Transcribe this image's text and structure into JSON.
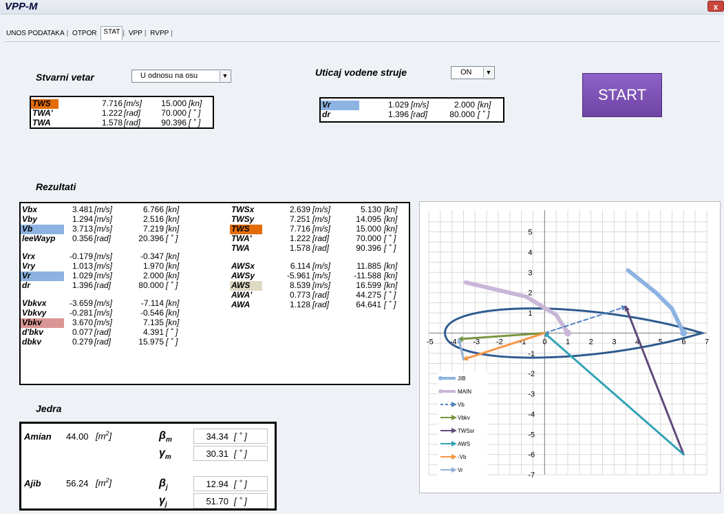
{
  "window": {
    "title": "VPP-M",
    "close_label": "x"
  },
  "tabs": [
    {
      "label": "UNOS PODATAKA",
      "active": false
    },
    {
      "label": "OTPOR",
      "active": false
    },
    {
      "label": "STAT",
      "active": true
    },
    {
      "label": "VPP",
      "active": false
    },
    {
      "label": "RVPP",
      "active": false
    }
  ],
  "stvarni_vetar": {
    "heading": "Stvarni vetar",
    "dropdown_value": "U odnosu na osu",
    "rows": [
      {
        "name": "TWS",
        "v1": "7.716",
        "u1": "[m/s]",
        "v2": "15.000",
        "u2": "[kn]",
        "highlight": "#e36c09"
      },
      {
        "name": "TWA'",
        "v1": "1.222",
        "u1": "[rad]",
        "v2": "70.000",
        "u2": "[ ˚ ]",
        "highlight": ""
      },
      {
        "name": "TWA",
        "v1": "1.578",
        "u1": "[rad]",
        "v2": "90.396",
        "u2": "[ ˚ ]",
        "highlight": ""
      }
    ]
  },
  "uticaj": {
    "heading": "Uticaj vodene struje",
    "dropdown_value": "ON",
    "rows": [
      {
        "name": "Vr",
        "v1": "1.029",
        "u1": "[m/s]",
        "v2": "2.000",
        "u2": "[kn]",
        "highlight": "#8db3e2"
      },
      {
        "name": "dr",
        "v1": "1.396",
        "u1": "[rad]",
        "v2": "80.000",
        "u2": "[ ˚ ]",
        "highlight": ""
      }
    ]
  },
  "start_label": "START",
  "rezultati": {
    "heading": "Rezultati",
    "left_rows": [
      {
        "name": "Vbx",
        "v1": "3.481",
        "u1": "[m/s]",
        "v2": "6.766",
        "u2": "[kn]",
        "highlight": ""
      },
      {
        "name": "Vby",
        "v1": "1.294",
        "u1": "[m/s]",
        "v2": "2.516",
        "u2": "[kn]",
        "highlight": ""
      },
      {
        "name": "Vb",
        "v1": "3.713",
        "u1": "[m/s]",
        "v2": "7.219",
        "u2": "[kn]",
        "highlight": "#8db3e2"
      },
      {
        "name": "leeWayp",
        "v1": "0.356",
        "u1": "[rad]",
        "v2": "20.396",
        "u2": "[ ˚ ]",
        "highlight": ""
      },
      {
        "name": "Vrx",
        "v1": "-0.179",
        "u1": "[m/s]",
        "v2": "-0.347",
        "u2": "[kn]",
        "highlight": ""
      },
      {
        "name": "Vry",
        "v1": "1.013",
        "u1": "[m/s]",
        "v2": "1.970",
        "u2": "[kn]",
        "highlight": ""
      },
      {
        "name": "Vr",
        "v1": "1.029",
        "u1": "[m/s]",
        "v2": "2.000",
        "u2": "[kn]",
        "highlight": "#8db3e2"
      },
      {
        "name": "dr",
        "v1": "1.396",
        "u1": "[rad]",
        "v2": "80.000",
        "u2": "[ ˚ ]",
        "highlight": ""
      },
      {
        "name": "Vbkvx",
        "v1": "-3.659",
        "u1": "[m/s]",
        "v2": "-7.114",
        "u2": "[kn]",
        "highlight": ""
      },
      {
        "name": "Vbkvy",
        "v1": "-0.281",
        "u1": "[m/s]",
        "v2": "-0.546",
        "u2": "[kn]",
        "highlight": ""
      },
      {
        "name": "Vbkv",
        "v1": "3.670",
        "u1": "[m/s]",
        "v2": "7.135",
        "u2": "[kn]",
        "highlight": "#da9694"
      },
      {
        "name": "d'bkv",
        "v1": "0.077",
        "u1": "[rad]",
        "v2": "4.391",
        "u2": "[ ˚ ]",
        "highlight": ""
      },
      {
        "name": "dbkv",
        "v1": "0.279",
        "u1": "[rad]",
        "v2": "15.975",
        "u2": "[ ˚ ]",
        "highlight": ""
      }
    ],
    "right_rows": [
      {
        "name": "TWSx",
        "v1": "2.639",
        "u1": "[m/s]",
        "v2": "5.130",
        "u2": "[kn]",
        "highlight": ""
      },
      {
        "name": "TWSy",
        "v1": "7.251",
        "u1": "[m/s]",
        "v2": "14.095",
        "u2": "[kn]",
        "highlight": ""
      },
      {
        "name": "TWS",
        "v1": "7.716",
        "u1": "[m/s]",
        "v2": "15.000",
        "u2": "[kn]",
        "highlight": "#e36c09"
      },
      {
        "name": "TWA'",
        "v1": "1.222",
        "u1": "[rad]",
        "v2": "70.000",
        "u2": "[ ˚ ]",
        "highlight": ""
      },
      {
        "name": "TWA",
        "v1": "1.578",
        "u1": "[rad]",
        "v2": "90.396",
        "u2": "[ ˚ ]",
        "highlight": ""
      },
      {
        "name": "AWSx",
        "v1": "6.114",
        "u1": "[m/s]",
        "v2": "11.885",
        "u2": "[kn]",
        "highlight": ""
      },
      {
        "name": "AWSy",
        "v1": "-5.961",
        "u1": "[m/s]",
        "v2": "-11.588",
        "u2": "[kn]",
        "highlight": ""
      },
      {
        "name": "AWS",
        "v1": "8.539",
        "u1": "[m/s]",
        "v2": "16.599",
        "u2": "[kn]",
        "highlight": "#ddd9c3"
      },
      {
        "name": "AWA'",
        "v1": "0.773",
        "u1": "[rad]",
        "v2": "44.275",
        "u2": "[ ˚ ]",
        "highlight": ""
      },
      {
        "name": "AWA",
        "v1": "1.128",
        "u1": "[rad]",
        "v2": "64.641",
        "u2": "[ ˚ ]",
        "highlight": ""
      }
    ]
  },
  "jedra": {
    "heading": "Jedra",
    "amian_label": "Amian",
    "amian_value": "44.00",
    "ajib_label": "Ajib",
    "ajib_value": "56.24",
    "area_unit": "[m",
    "area_unit_sup": "2",
    "area_unit_close": "]",
    "beta_m_sym": "β",
    "beta_m_sub": "m",
    "beta_m_value": "34.34",
    "beta_m_unit": "[ ˚ ]",
    "gamma_m_sym": "γ",
    "gamma_m_sub": "m",
    "gamma_m_value": "30.31",
    "gamma_m_unit": "[ ˚ ]",
    "beta_j_sym": "β",
    "beta_j_sub": "j",
    "beta_j_value": "12.94",
    "beta_j_unit": "[ ˚ ]",
    "gamma_j_sym": "γ",
    "gamma_j_sub": "j",
    "gamma_j_value": "51.70",
    "gamma_j_unit": "[ ˚ ]"
  },
  "chart_data": {
    "type": "scatter",
    "title": "",
    "xlabel": "",
    "ylabel": "",
    "xlim": [
      -5,
      7
    ],
    "ylim": [
      -7,
      5
    ],
    "x_ticks": [
      -5,
      -4,
      -3,
      -2,
      -1,
      0,
      1,
      2,
      3,
      4,
      5,
      6,
      7
    ],
    "y_ticks": [
      5,
      4,
      3,
      2,
      1,
      0,
      -1,
      -2,
      -3,
      -4,
      -5,
      -6,
      -7
    ],
    "grid": true,
    "legend": "bottom-left",
    "hull": {
      "x_min": -4.3,
      "x_max": 6.8,
      "y_center": 0.0,
      "half_width": 1.2,
      "color": "#2e5b8e"
    },
    "series": [
      {
        "name": "JIB",
        "color": "#8db3e2",
        "points": [
          [
            6.0,
            0.0
          ],
          [
            5.5,
            1.2
          ],
          [
            4.8,
            2.0
          ],
          [
            3.6,
            3.1
          ]
        ],
        "style": "thick",
        "start_marker": true
      },
      {
        "name": "MAIN",
        "color": "#c9b6d8",
        "points": [
          [
            1.0,
            0.0
          ],
          [
            0.5,
            0.9
          ],
          [
            -0.8,
            1.8
          ],
          [
            -3.4,
            2.5
          ]
        ],
        "style": "thick",
        "start_marker": true
      },
      {
        "name": "Vb",
        "color": "#4f81bd",
        "points": [
          [
            0.0,
            0.0
          ],
          [
            3.5,
            1.3
          ]
        ],
        "style": "dashed",
        "arrow": true
      },
      {
        "name": "Vbkv",
        "color": "#77933c",
        "points": [
          [
            0.0,
            0.0
          ],
          [
            -3.7,
            -0.3
          ]
        ],
        "style": "solid",
        "arrow": true
      },
      {
        "name": "TWSsr",
        "color": "#60497a",
        "points": [
          [
            6.0,
            -6.0
          ],
          [
            3.5,
            1.3
          ]
        ],
        "style": "solid",
        "arrow": true
      },
      {
        "name": "AWS",
        "color": "#31a3b6",
        "points": [
          [
            6.0,
            -6.0
          ],
          [
            0.0,
            0.0
          ]
        ],
        "style": "solid",
        "arrow": true
      },
      {
        "name": "-Vb",
        "color": "#f79646",
        "points": [
          [
            0.0,
            0.0
          ],
          [
            -3.5,
            -1.3
          ]
        ],
        "style": "solid",
        "arrow": true
      },
      {
        "name": "Vr",
        "color": "#95b3d7",
        "points": [
          [
            -3.5,
            -1.3
          ],
          [
            -3.7,
            -0.3
          ]
        ],
        "style": "solid",
        "arrow": true
      }
    ]
  }
}
